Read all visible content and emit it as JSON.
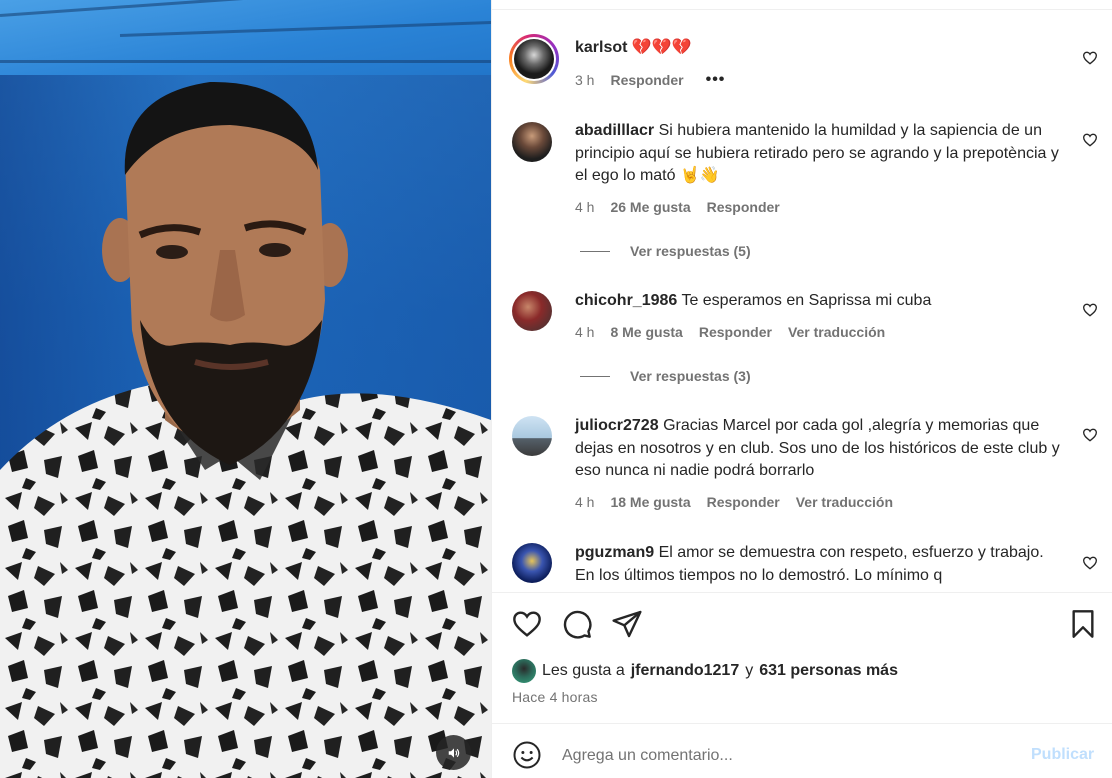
{
  "media": {
    "volume_icon": "speaker-icon"
  },
  "post_author": {
    "username": "karlsot",
    "caption": "💔💔💔",
    "time": "3 h",
    "reply_label": "Responder",
    "more_icon": "ellipsis-icon"
  },
  "comments": [
    {
      "username": "abadilllacr",
      "text": "Si hubiera mantenido la humildad y la sapiencia de un principio aquí se hubiera retirado pero se agrando y la prepotència y el ego lo mató 🤘👋",
      "time": "4 h",
      "likes": "26 Me gusta",
      "reply_label": "Responder",
      "view_replies": "Ver respuestas (5)"
    },
    {
      "username": "chicohr_1986",
      "text": "Te esperamos en Saprissa mi cuba",
      "time": "4 h",
      "likes": "8 Me gusta",
      "reply_label": "Responder",
      "translate_label": "Ver traducción",
      "view_replies": "Ver respuestas (3)"
    },
    {
      "username": "juliocr2728",
      "text": "Gracias Marcel por cada gol ,alegría y memorias que dejas en nosotros y en club. Sos uno de los históricos de este club y eso nunca ni nadie podrá borrarlo",
      "time": "4 h",
      "likes": "18 Me gusta",
      "reply_label": "Responder",
      "translate_label": "Ver traducción"
    },
    {
      "username": "pguzman9",
      "text": "El amor se demuestra con respeto, esfuerzo y trabajo. En los últimos tiempos no lo demostró. Lo mínimo q"
    }
  ],
  "actions": {
    "like_icon": "heart-icon",
    "comment_icon": "comment-bubble-icon",
    "share_icon": "paper-plane-icon",
    "save_icon": "bookmark-icon"
  },
  "likes": {
    "prefix": "Les gusta a",
    "user": "jfernando1217",
    "connector": "y",
    "others": "631 personas más"
  },
  "posted_ago": "Hace 4 horas",
  "add_comment": {
    "placeholder": "Agrega un comentario...",
    "publish_label": "Publicar",
    "emoji_icon": "smiley-icon"
  },
  "colors": {
    "primary_text": "#262626",
    "secondary_text": "#737373",
    "divider": "#efefef",
    "publish_disabled": "#c0dffd"
  }
}
